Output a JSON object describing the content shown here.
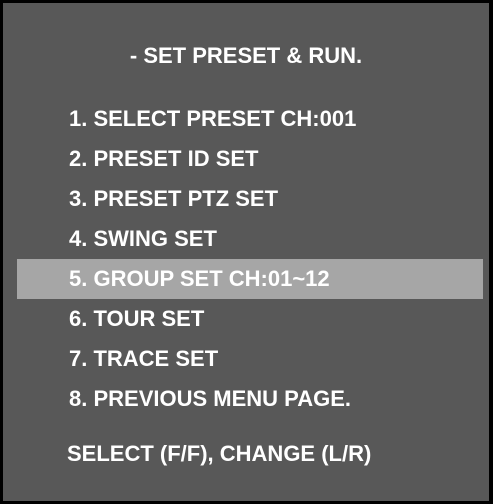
{
  "title": "- SET PRESET & RUN.",
  "menu": {
    "selected_index": 4,
    "items": [
      {
        "label": "1. SELECT PRESET CH:001"
      },
      {
        "label": "2. PRESET ID SET"
      },
      {
        "label": "3. PRESET PTZ SET"
      },
      {
        "label": "4. SWING SET"
      },
      {
        "label": "5. GROUP SET CH:01~12"
      },
      {
        "label": "6. TOUR SET"
      },
      {
        "label": "7. TRACE SET"
      },
      {
        "label": "8. PREVIOUS MENU PAGE."
      }
    ]
  },
  "footer": "SELECT (F/F), CHANGE (L/R)",
  "colors": {
    "background": "#585858",
    "highlight": "#a6a6a6",
    "text": "#ffffff",
    "border": "#000000"
  }
}
